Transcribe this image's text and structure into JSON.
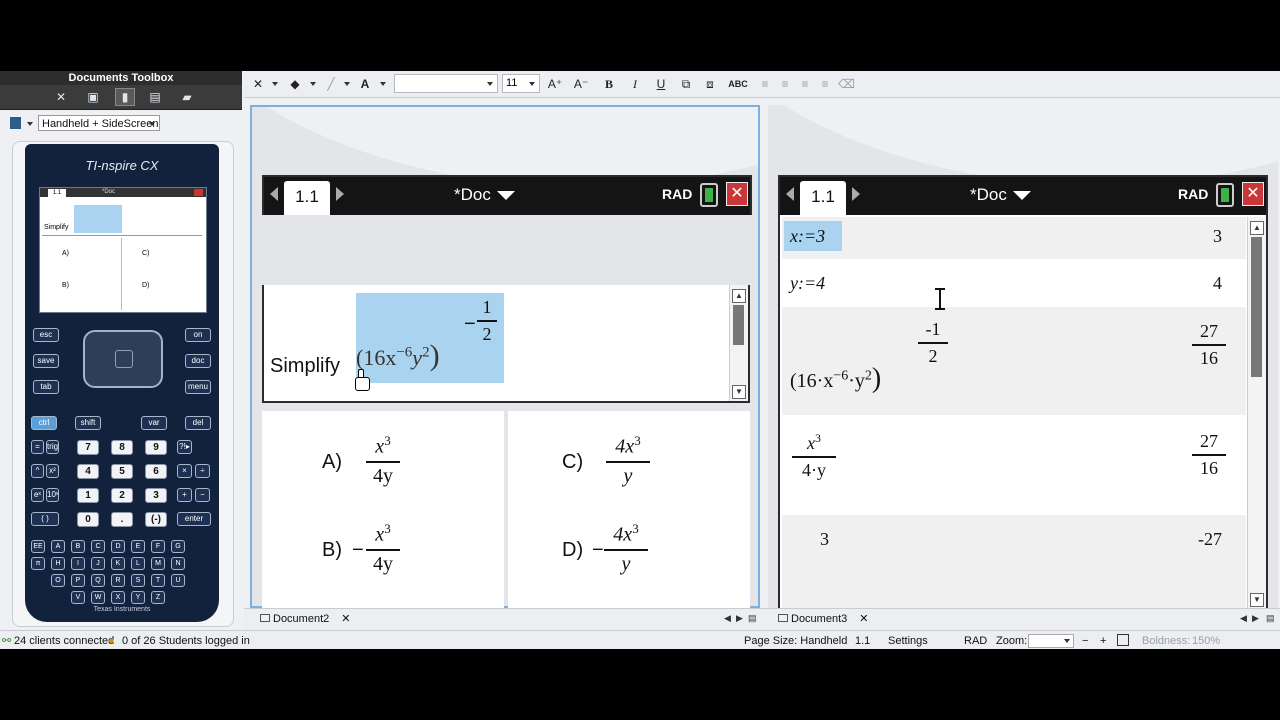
{
  "toolbox": {
    "title": "Documents Toolbox",
    "icons": [
      "tools-icon",
      "page-sorter-icon",
      "handheld-icon",
      "utilities-icon",
      "content-explorer-icon"
    ],
    "layout_option": "Handheld + SideScreen"
  },
  "handheld": {
    "brand": "TI-nspire CX",
    "maker": "Texas Instruments",
    "mini_tab": "1.1",
    "mini_doc": "*Doc",
    "mini_question": "Simplify",
    "mini_choices": [
      "A)",
      "C)",
      "B)",
      "D)"
    ],
    "keys": {
      "esc": "esc",
      "save": "save",
      "on": "on",
      "doc": "doc",
      "tab": "tab",
      "menu": "menu",
      "ctrl": "ctrl",
      "shift": "shift",
      "var": "var",
      "del": "del",
      "enter": "enter",
      "trig": "trig",
      "xsq": "x²",
      "ex": "eˣ",
      "tenx": "10ˣ",
      "paren": "( )",
      "neg": "(-)",
      "dot": ".",
      "plus": "+",
      "minus": "−",
      "times": "×",
      "div": "÷",
      "eq": "=",
      "caret": "^",
      "ee": "EE",
      "pi": "π",
      "flag": "?!▸",
      "digits": [
        "7",
        "8",
        "9",
        "4",
        "5",
        "6",
        "1",
        "2",
        "3",
        "0"
      ],
      "letters": [
        "A",
        "B",
        "C",
        "D",
        "E",
        "F",
        "G",
        "H",
        "I",
        "J",
        "K",
        "L",
        "M",
        "N",
        "O",
        "P",
        "Q",
        "R",
        "S",
        "T",
        "U",
        "V",
        "W",
        "X",
        "Y",
        "Z"
      ]
    }
  },
  "toolbar": {
    "font_size": "11",
    "bold": "B",
    "italic": "I",
    "underline": "U",
    "spell": "ABC"
  },
  "left_doc": {
    "tab": "1.1",
    "doc_name": "*Doc",
    "mode": "RAD",
    "close": "✕",
    "question": "Simplify",
    "expr_base": "(16x",
    "expr_exp1": "−6",
    "expr_y": "y",
    "expr_exp2": "2",
    "expr_close": ")",
    "outer_exp_sign": "−",
    "outer_exp_num": "1",
    "outer_exp_den": "2",
    "choices": [
      {
        "label": "A)",
        "sign": "",
        "num": "x",
        "num_exp": "3",
        "den": "4y"
      },
      {
        "label": "C)",
        "sign": "",
        "num": "4x",
        "num_exp": "3",
        "den": "y"
      },
      {
        "label": "B)",
        "sign": "−",
        "num": "x",
        "num_exp": "3",
        "den": "4y"
      },
      {
        "label": "D)",
        "sign": "−",
        "num": "4x",
        "num_exp": "3",
        "den": "y"
      }
    ]
  },
  "right_doc": {
    "tab": "1.1",
    "doc_name": "*Doc",
    "mode": "RAD",
    "close": "✕",
    "rows": [
      {
        "expr": "x:=3",
        "result": "3"
      },
      {
        "expr": "y:=4",
        "result": "4"
      },
      {
        "expr_base": "(16·x",
        "expr_exp1": "−6",
        "expr_dot": "·y",
        "expr_exp2": "2",
        "expr_close": ")",
        "exp_num": "-1",
        "exp_den": "2",
        "res_num": "27",
        "res_den": "16"
      },
      {
        "num": "x",
        "num_exp": "3",
        "den": "4·y",
        "res_num": "27",
        "res_den": "16"
      },
      {
        "expr": "3",
        "result": "-27"
      }
    ]
  },
  "bottom_tabs": [
    {
      "label": "Document2",
      "close": "✕"
    },
    {
      "label": "Document3",
      "close": "✕"
    }
  ],
  "status": {
    "clients": "24 clients connected",
    "students": "0 of 26 Students logged in",
    "page_size": "Page Size: Handheld",
    "page_num": "1.1",
    "settings": "Settings",
    "mode": "RAD",
    "zoom_label": "Zoom:",
    "boldness": "Boldness:",
    "boldness_value": "150%"
  }
}
